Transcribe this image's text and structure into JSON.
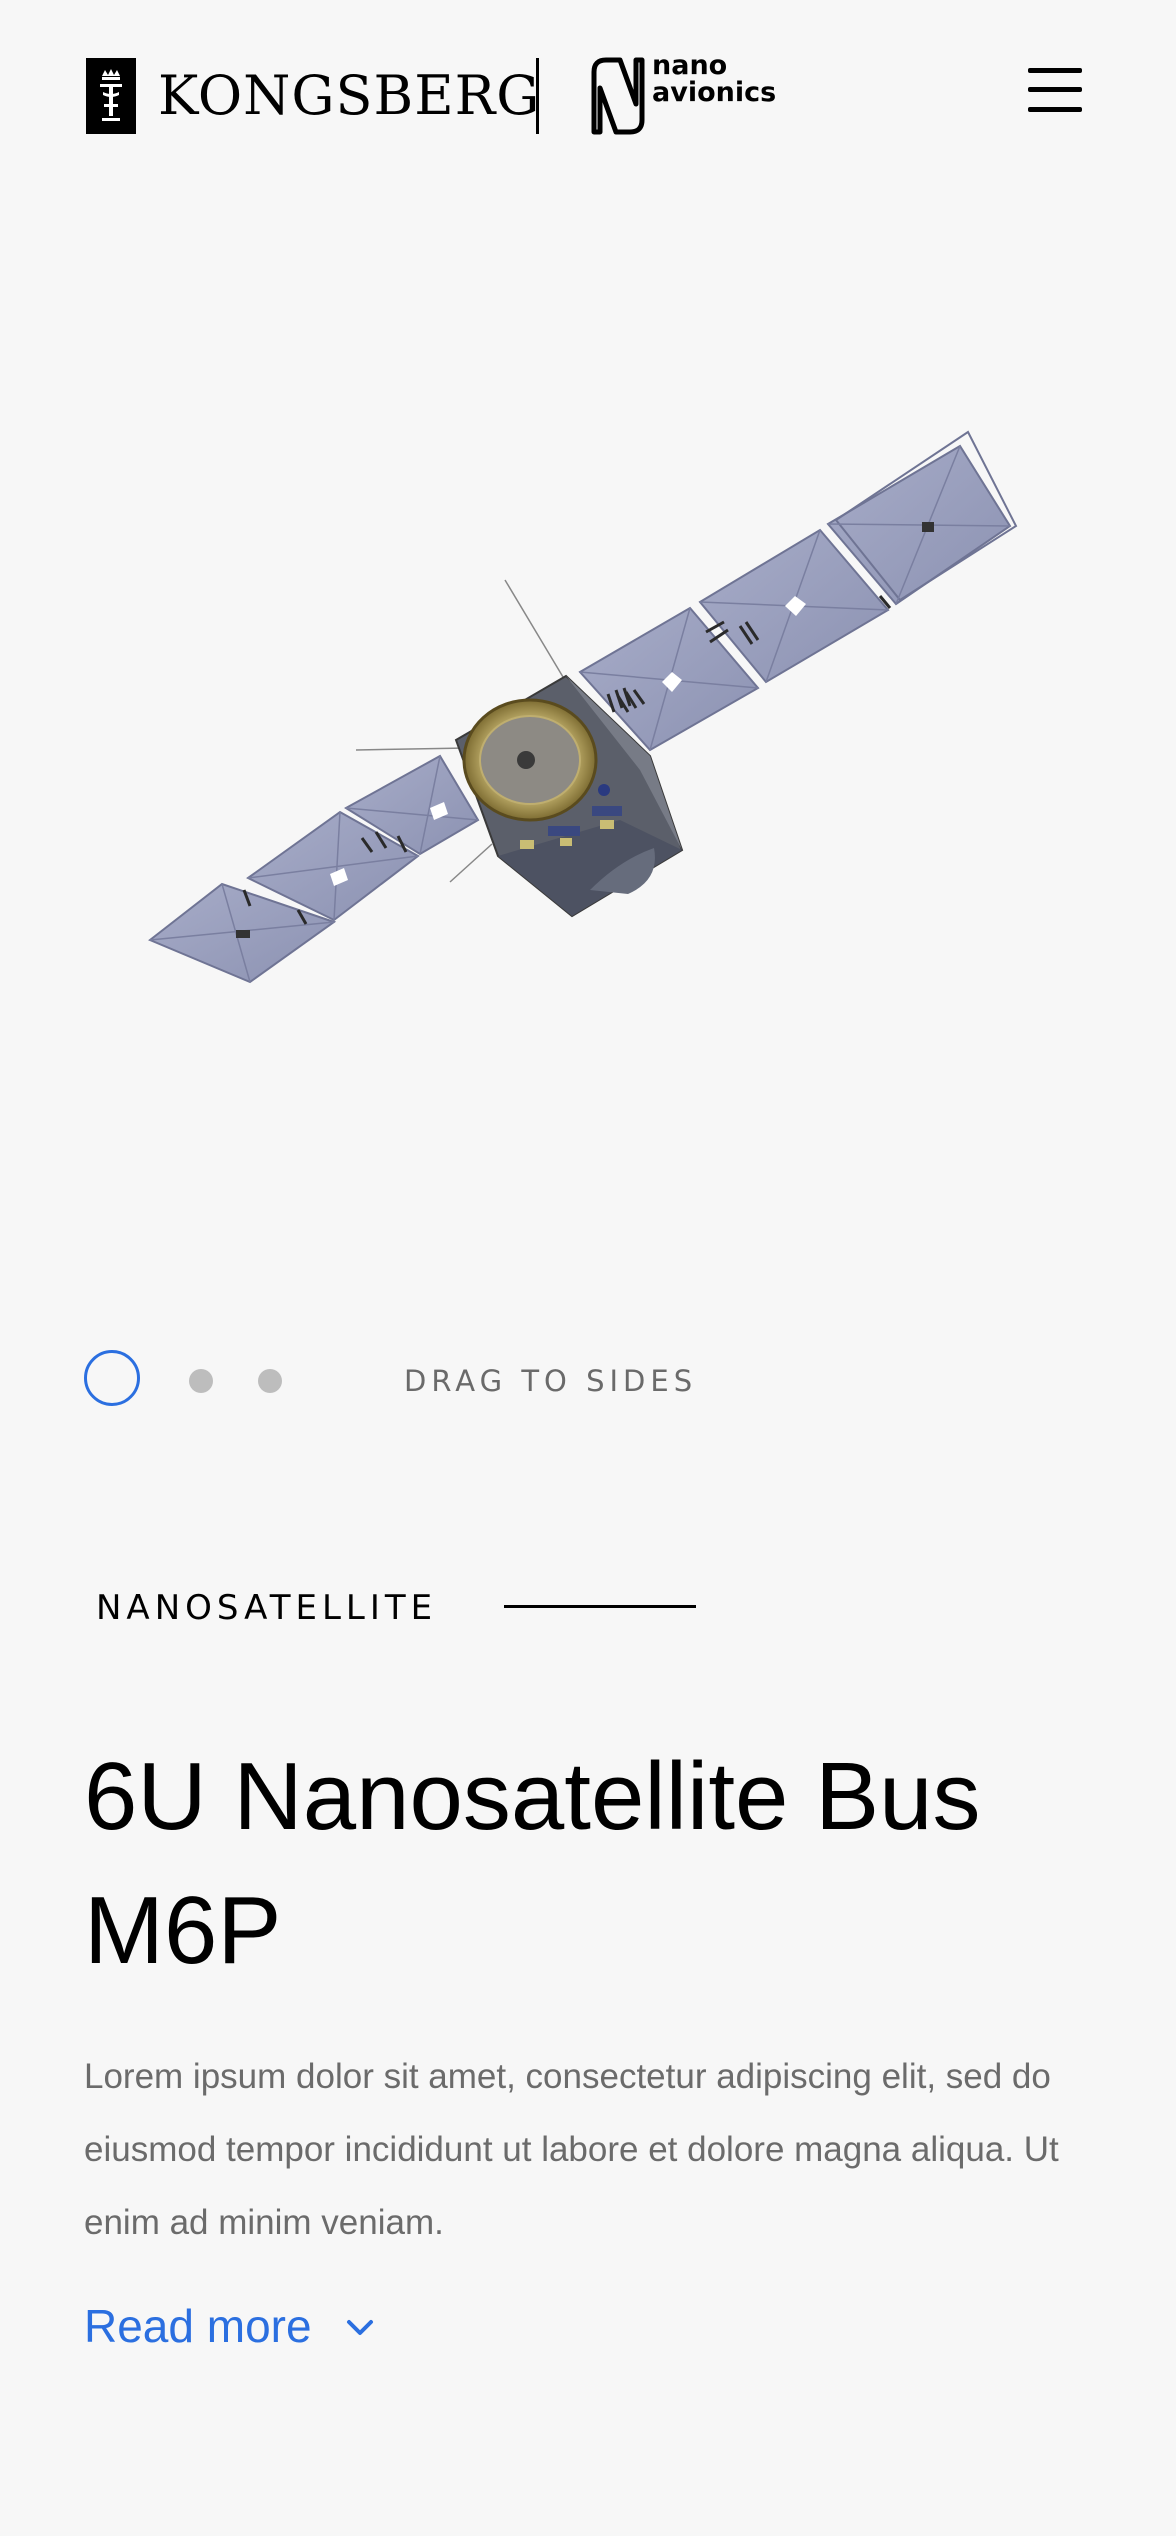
{
  "header": {
    "brand_primary": "KONGSBERG",
    "brand_secondary_line1": "nano",
    "brand_secondary_line2": "avionics",
    "menu_icon": "hamburger-menu-icon"
  },
  "carousel": {
    "slide_count": 3,
    "active_index": 0,
    "hint": "DRAG TO SIDES"
  },
  "product": {
    "category": "NANOSATELLITE",
    "title": "6U Nanosatellite Bus M6P",
    "description": "Lorem ipsum dolor sit amet, consectetur adipiscing elit, sed do eiusmod tempor incididunt ut labore et dolore magna aliqua. Ut enim ad minim veniam.",
    "read_more": "Read more",
    "read_more_icon": "chevron-down-icon"
  },
  "colors": {
    "background": "#f7f7f7",
    "accent": "#2b6fe0",
    "text": "#000000",
    "muted_text": "#6b6b6b",
    "inactive_dot": "#bdbdbd",
    "solar_panel": "#9aa0be"
  }
}
